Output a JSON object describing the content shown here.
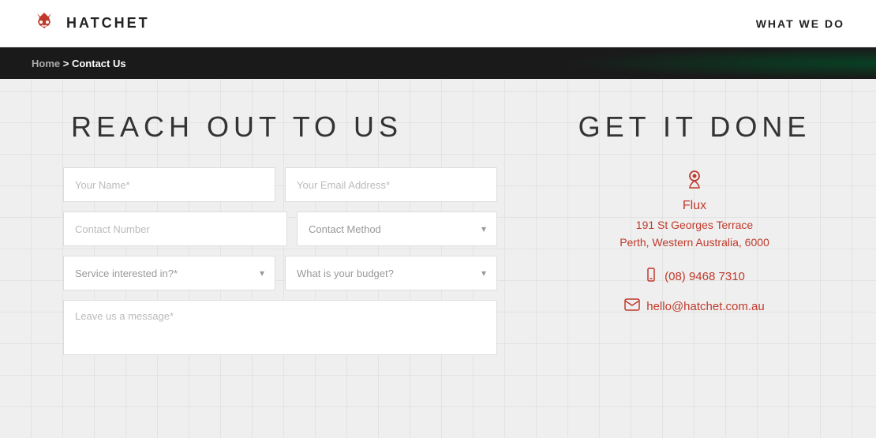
{
  "header": {
    "logo_text": "HATCHET",
    "nav_what_we_do": "WHAT WE DO"
  },
  "breadcrumb": {
    "home_label": "Home",
    "separator": ">",
    "current_page": "Contact Us"
  },
  "reach_out": {
    "title": "REACH OUT TO US",
    "name_placeholder": "Your Name*",
    "email_placeholder": "Your Email Address*",
    "contact_number_placeholder": "Contact Number",
    "contact_method_placeholder": "Contact Method",
    "service_placeholder": "Service interested in?*",
    "budget_placeholder": "What is your budget?",
    "message_placeholder": "Leave us a message*"
  },
  "get_it_done": {
    "title": "GET IT DONE",
    "company_name": "Flux",
    "address_line1": "191 St Georges Terrace",
    "address_line2": "Perth, Western Australia, 6000",
    "phone": "(08) 9468 7310",
    "email": "hello@hatchet.com.au"
  },
  "icons": {
    "chevron_down": "▾",
    "phone": "📱",
    "email": "✉",
    "building": "🏢"
  }
}
